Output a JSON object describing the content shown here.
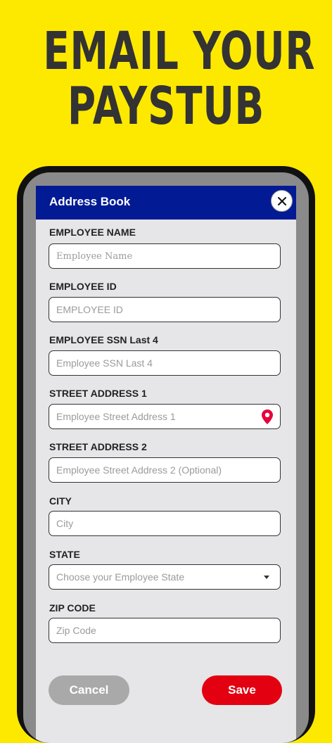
{
  "promo": {
    "headline_line1": "EMAIL YOUR",
    "headline_line2": "PAYSTUB"
  },
  "modal": {
    "title": "Address Book",
    "close_icon": "close-icon"
  },
  "fields": [
    {
      "label": "EMPLOYEE NAME",
      "placeholder": "Employee Name"
    },
    {
      "label": "EMPLOYEE ID",
      "placeholder": "EMPLOYEE ID"
    },
    {
      "label": "EMPLOYEE SSN Last 4",
      "placeholder": "Employee SSN Last 4"
    },
    {
      "label": "STREET ADDRESS 1",
      "placeholder": "Employee Street Address 1",
      "icon": "location-pin-icon"
    },
    {
      "label": "STREET ADDRESS 2",
      "placeholder": "Employee Street Address 2 (Optional)"
    },
    {
      "label": "CITY",
      "placeholder": "City"
    },
    {
      "label": "STATE",
      "placeholder": "Choose your Employee State",
      "icon": "chevron-down-icon"
    },
    {
      "label": "ZIP CODE",
      "placeholder": "Zip Code"
    }
  ],
  "buttons": {
    "cancel_label": "Cancel",
    "save_label": "Save"
  },
  "colors": {
    "background": "#fde900",
    "header": "#021a94",
    "save": "#e30011",
    "cancel": "#a9a9a9",
    "pin": "#e8003d"
  }
}
